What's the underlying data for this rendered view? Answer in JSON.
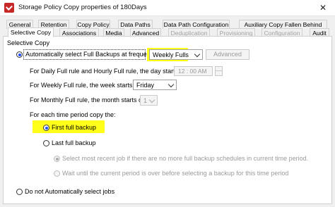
{
  "window": {
    "title": "Storage Policy Copy properties of 180Days",
    "close_glyph": "✕"
  },
  "tabs_row1": [
    {
      "label": "General"
    },
    {
      "label": "Retention"
    },
    {
      "label": "Copy Policy"
    },
    {
      "label": "Data Paths"
    },
    {
      "label": "Data Path Configuration"
    },
    {
      "label": "Auxiliary Copy Fallen Behind"
    }
  ],
  "tabs_row2": [
    {
      "label": "Selective Copy",
      "state": "active"
    },
    {
      "label": "Associations",
      "state": "normal"
    },
    {
      "label": "Media",
      "state": "normal"
    },
    {
      "label": "Advanced",
      "state": "normal"
    },
    {
      "label": "Deduplication",
      "state": "disabled"
    },
    {
      "label": "Provisioning",
      "state": "disabled"
    },
    {
      "label": "Configuration",
      "state": "disabled"
    },
    {
      "label": "Audit",
      "state": "normal"
    }
  ],
  "selective_copy": {
    "group_label": "Selective Copy",
    "auto_select_label": "Automatically select Full Backups at frequency",
    "frequency_value": "Weekly Fulls",
    "advanced_button": "Advanced",
    "daily_label": "For Daily Full rule and Hourly Full rule, the day starts on",
    "daily_time": "12 : 00 AM",
    "weekly_label": "For Weekly Full rule, the week starts on",
    "weekly_value": "Friday",
    "monthly_label": "For Monthly Full rule, the month starts on",
    "monthly_value": "1",
    "period_label": "For each time period copy the:",
    "first_full_label": "First full backup",
    "last_full_label": "Last full backup",
    "last_option1": "Select most recent job if there are no more full backup schedules in current time period.",
    "last_option2": "Wait until the current period is over before selecting a backup for this time period",
    "manual_label": "Do not Automatically select jobs"
  },
  "colors": {
    "highlight": "#ffff1a",
    "radio_selected": "#1f4fff"
  }
}
